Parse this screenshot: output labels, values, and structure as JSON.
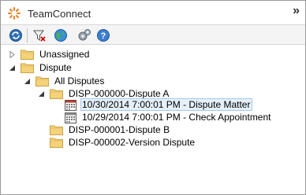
{
  "window": {
    "title": "TeamConnect",
    "collapse_glyph": "»"
  },
  "toolbar": {
    "buttons": [
      {
        "name": "refresh-button",
        "icon": "refresh-icon"
      },
      {
        "name": "filter-button",
        "icon": "filter-icon"
      },
      {
        "name": "globe-button",
        "icon": "globe-icon"
      },
      {
        "name": "settings-button",
        "icon": "gears-icon"
      },
      {
        "name": "help-button",
        "icon": "help-icon"
      }
    ]
  },
  "tree": {
    "unassigned": "Unassigned",
    "dispute": "Dispute",
    "all_disputes": "All Disputes",
    "dispute_a": "DISP-000000-Dispute A",
    "event_1": "10/30/2014 7:00:01 PM - Dispute Matter",
    "event_2": "10/29/2014 7:00:01 PM - Check Appointment",
    "dispute_b": "DISP-000001-Dispute B",
    "dispute_version": "DISP-000002-Version Dispute",
    "selected_item": "10/30/2014 7:00:01 PM - Dispute Matter"
  },
  "colors": {
    "folder": "#f3d27a",
    "selection": "#e5f0fb",
    "logo": "#f07d22"
  }
}
